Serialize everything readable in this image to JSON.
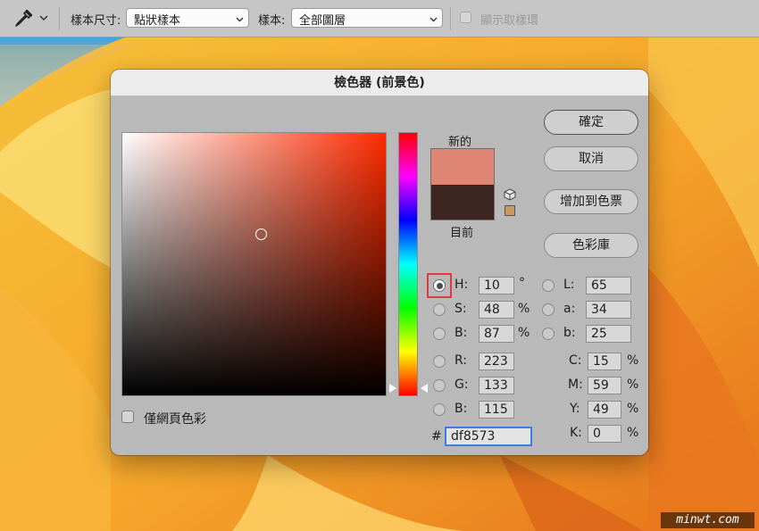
{
  "options_bar": {
    "tool_icon": "eyedropper-icon",
    "sample_size_label": "樣本尺寸:",
    "sample_size_value": "點狀樣本",
    "sample_label": "樣本:",
    "sample_value": "全部圖層",
    "show_ring_label": "顯示取樣環",
    "show_ring_checked": false
  },
  "dialog": {
    "title": "檢色器 (前景色)",
    "buttons": {
      "ok": "確定",
      "cancel": "取消",
      "add_to_swatches": "增加到色票",
      "color_libraries": "色彩庫"
    },
    "swatch": {
      "new_label": "新的",
      "current_label": "目前",
      "new_color": "#df8573",
      "current_color": "#3d2521"
    },
    "only_web_colors": {
      "label": "僅網頁色彩",
      "checked": false
    },
    "hsb": {
      "h": {
        "label": "H:",
        "value": "10",
        "unit": "°",
        "selected": true
      },
      "s": {
        "label": "S:",
        "value": "48",
        "unit": "%"
      },
      "b": {
        "label": "B:",
        "value": "87",
        "unit": "%"
      }
    },
    "rgb": {
      "r": {
        "label": "R:",
        "value": "223"
      },
      "g": {
        "label": "G:",
        "value": "133"
      },
      "b": {
        "label": "B:",
        "value": "115"
      }
    },
    "lab": {
      "l": {
        "label": "L:",
        "value": "65"
      },
      "a": {
        "label": "a:",
        "value": "34"
      },
      "b": {
        "label": "b:",
        "value": "25"
      }
    },
    "cmyk": {
      "c": {
        "label": "C:",
        "value": "15",
        "unit": "%"
      },
      "m": {
        "label": "M:",
        "value": "59",
        "unit": "%"
      },
      "y": {
        "label": "Y:",
        "value": "49",
        "unit": "%"
      },
      "k": {
        "label": "K:",
        "value": "0",
        "unit": "%"
      }
    },
    "hex": {
      "label": "#",
      "value": "df8573"
    }
  },
  "watermark": "minwt.com"
}
